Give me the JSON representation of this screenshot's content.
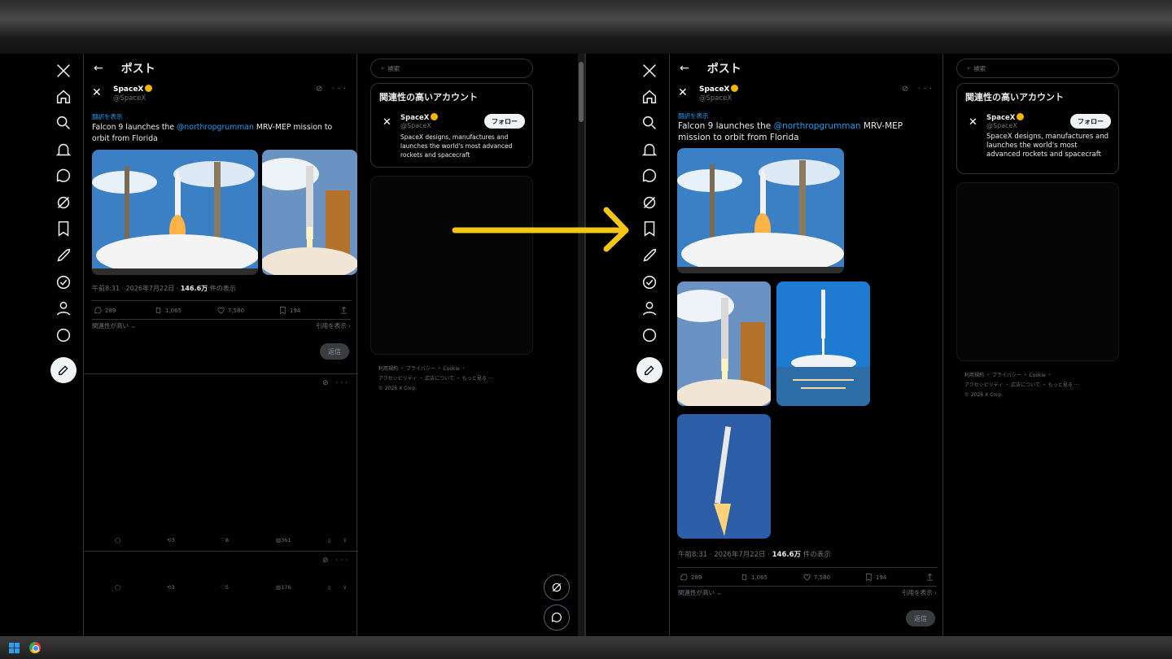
{
  "header": {
    "back": "←",
    "title": "ポスト"
  },
  "nav_icons": [
    "x-logo-icon",
    "home-icon",
    "search-icon",
    "bell-icon",
    "message-icon",
    "grok-icon",
    "bookmark-icon",
    "rocket-icon",
    "verified-icon",
    "profile-icon",
    "more-icon"
  ],
  "post": {
    "name": "SpaceX",
    "handle": "@SpaceX",
    "translate": "翻訳を表示",
    "text_before": "Falcon 9 launches the ",
    "mention": "@northropgrumman",
    "text_after": " MRV-MEP mission to orbit from Florida",
    "time": "午前8:31 · 2026年7月22日 · ",
    "views": "146.6万",
    "views_label": "件の表示",
    "replies": "289",
    "reposts": "1,065",
    "likes": "7,580",
    "bookmarks": "194",
    "relevance": "関連性が高い",
    "quotes": "引用を表示",
    "reply_button": "返信"
  },
  "replies_list": [
    {
      "replies": "",
      "reposts": "3",
      "likes": "8",
      "views": "361"
    },
    {
      "replies": "",
      "reposts": "3",
      "likes": "5",
      "views": "176"
    }
  ],
  "sidebar": {
    "search_placeholder": "検索",
    "related_title": "関連性の高いアカウント",
    "acct_name": "SpaceX",
    "acct_handle": "@SpaceX",
    "follow": "フォロー",
    "bio": "SpaceX designs, manufactures and launches the world's most advanced rockets and spacecraft",
    "footer_line1": "利用規約 ・ プライバシー ・ Cookie ・",
    "footer_line2": "アクセシビリティ ・ 広告について ・ もっと見る ···",
    "footer_line3": "© 2026 X Corp."
  },
  "colors": {
    "accent": "#1d9bf0",
    "arrow": "#f5c518",
    "verified": "#f4b400"
  }
}
